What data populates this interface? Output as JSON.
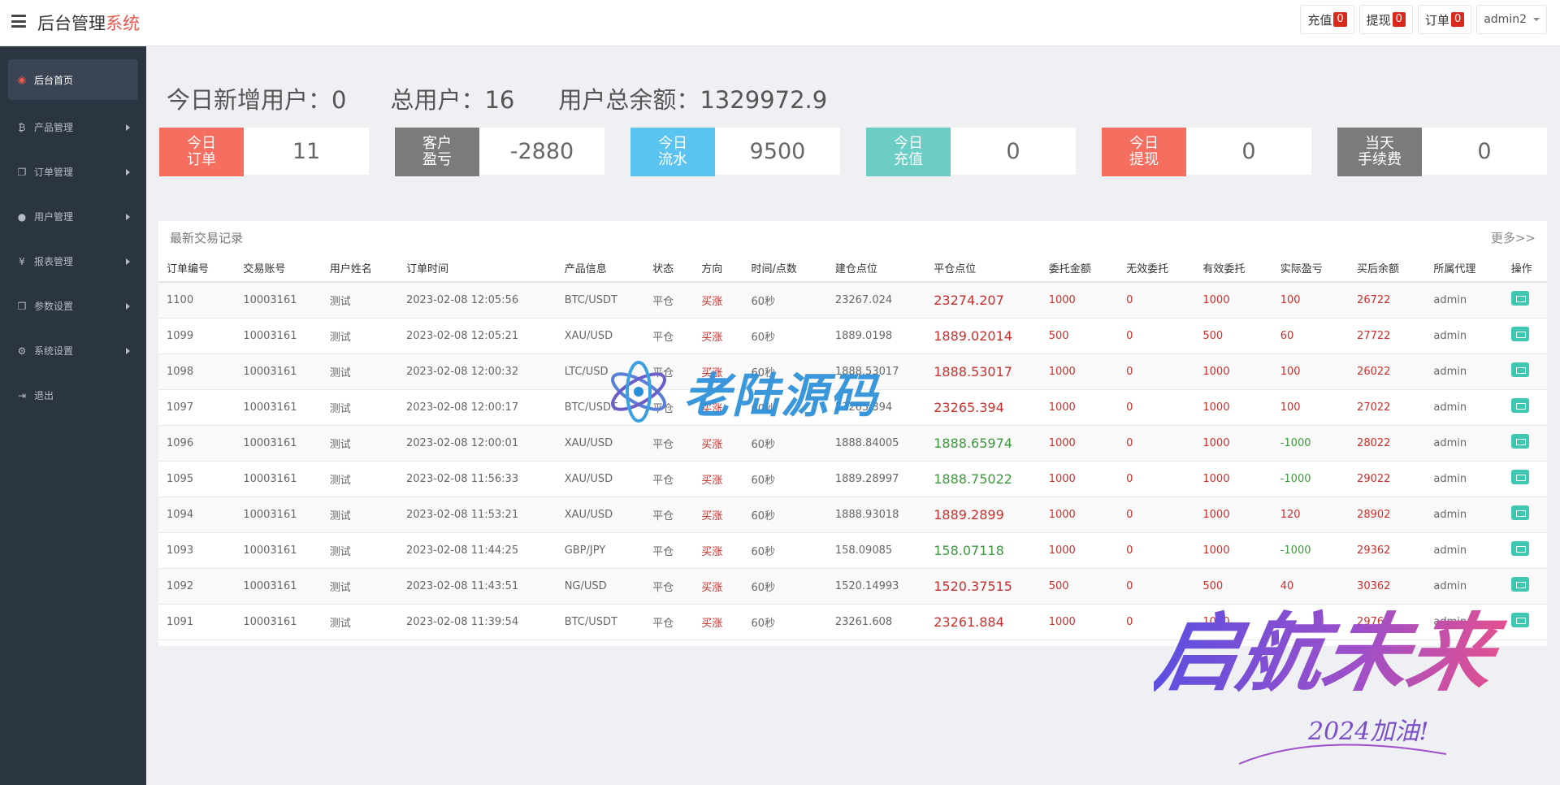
{
  "header": {
    "brand_main": "后台管理",
    "brand_accent": "系统",
    "recharge_label": "充值",
    "recharge_count": "0",
    "withdraw_label": "提现",
    "withdraw_count": "0",
    "orders_label": "订单",
    "orders_count": "0",
    "user": "admin2"
  },
  "sidebar": {
    "items": [
      {
        "label": "后台首页",
        "icon": "dashboard-icon"
      },
      {
        "label": "产品管理",
        "icon": "bitcoin-icon"
      },
      {
        "label": "订单管理",
        "icon": "copy-icon"
      },
      {
        "label": "用户管理",
        "icon": "user-icon"
      },
      {
        "label": "报表管理",
        "icon": "yen-icon"
      },
      {
        "label": "参数设置",
        "icon": "copy-icon"
      },
      {
        "label": "系统设置",
        "icon": "gears-icon"
      },
      {
        "label": "退出",
        "icon": "sign-out-icon"
      }
    ]
  },
  "summary": {
    "new_users": "今日新增用户：0",
    "total_users": "总用户：16",
    "total_balance": "用户总余额：1329972.9"
  },
  "cards": [
    {
      "label": "今日\n订单",
      "value": "11",
      "color": "#f56e5f"
    },
    {
      "label": "客户\n盈亏",
      "value": "-2880",
      "color": "#7b7b7b"
    },
    {
      "label": "今日\n流水",
      "value": "9500",
      "color": "#5ac3f0"
    },
    {
      "label": "今日\n充值",
      "value": "0",
      "color": "#6ccdc4"
    },
    {
      "label": "今日\n提现",
      "value": "0",
      "color": "#f56e5f"
    },
    {
      "label": "当天\n手续费",
      "value": "0",
      "color": "#7b7b7b"
    }
  ],
  "table": {
    "title": "最新交易记录",
    "more": "更多>>",
    "columns": [
      "订单编号",
      "交易账号",
      "用户姓名",
      "订单时间",
      "产品信息",
      "状态",
      "方向",
      "时间/点数",
      "建仓点位",
      "平仓点位",
      "委托金额",
      "无效委托",
      "有效委托",
      "实际盈亏",
      "买后余额",
      "所属代理",
      "操作"
    ],
    "rows": [
      [
        "1100",
        "10003161",
        "测试",
        "2023-02-08 12:05:56",
        "BTC/USDT",
        "平仓",
        "买涨",
        "60秒",
        "23267.024",
        "23274.207",
        "1000",
        "0",
        "1000",
        "100",
        "26722",
        "admin"
      ],
      [
        "1099",
        "10003161",
        "测试",
        "2023-02-08 12:05:21",
        "XAU/USD",
        "平仓",
        "买涨",
        "60秒",
        "1889.0198",
        "1889.02014",
        "500",
        "0",
        "500",
        "60",
        "27722",
        "admin"
      ],
      [
        "1098",
        "10003161",
        "测试",
        "2023-02-08 12:00:32",
        "LTC/USD",
        "平仓",
        "买涨",
        "60秒",
        "1888.53017",
        "1888.53017",
        "1000",
        "0",
        "1000",
        "100",
        "26022",
        "admin"
      ],
      [
        "1097",
        "10003161",
        "测试",
        "2023-02-08 12:00:17",
        "BTC/USDT",
        "平仓",
        "买涨",
        "60秒",
        "23265.394",
        "23265.394",
        "1000",
        "0",
        "1000",
        "100",
        "27022",
        "admin"
      ],
      [
        "1096",
        "10003161",
        "测试",
        "2023-02-08 12:00:01",
        "XAU/USD",
        "平仓",
        "买涨",
        "60秒",
        "1888.84005",
        "1888.65974",
        "1000",
        "0",
        "1000",
        "-1000",
        "28022",
        "admin"
      ],
      [
        "1095",
        "10003161",
        "测试",
        "2023-02-08 11:56:33",
        "XAU/USD",
        "平仓",
        "买涨",
        "60秒",
        "1889.28997",
        "1888.75022",
        "1000",
        "0",
        "1000",
        "-1000",
        "29022",
        "admin"
      ],
      [
        "1094",
        "10003161",
        "测试",
        "2023-02-08 11:53:21",
        "XAU/USD",
        "平仓",
        "买涨",
        "60秒",
        "1888.93018",
        "1889.2899",
        "1000",
        "0",
        "1000",
        "120",
        "28902",
        "admin"
      ],
      [
        "1093",
        "10003161",
        "测试",
        "2023-02-08 11:44:25",
        "GBP/JPY",
        "平仓",
        "买涨",
        "60秒",
        "158.09085",
        "158.07118",
        "1000",
        "0",
        "1000",
        "-1000",
        "29362",
        "admin"
      ],
      [
        "1092",
        "10003161",
        "测试",
        "2023-02-08 11:43:51",
        "NG/USD",
        "平仓",
        "买涨",
        "60秒",
        "1520.14993",
        "1520.37515",
        "500",
        "0",
        "500",
        "40",
        "30362",
        "admin"
      ],
      [
        "1091",
        "10003161",
        "测试",
        "2023-02-08 11:39:54",
        "BTC/USDT",
        "平仓",
        "买涨",
        "60秒",
        "23261.608",
        "23261.884",
        "1000",
        "0",
        "1000",
        "",
        "29762",
        "admin"
      ]
    ],
    "close_colors": [
      "red",
      "red",
      "red",
      "red",
      "green",
      "green",
      "red",
      "green",
      "red",
      "red"
    ],
    "pnl_colors": [
      "red",
      "red",
      "red",
      "red",
      "green",
      "green",
      "red",
      "green",
      "red",
      "red"
    ]
  },
  "watermarks": {
    "site": "老陆源码",
    "slogan": "启航未来",
    "tagline": "2024加油!"
  }
}
